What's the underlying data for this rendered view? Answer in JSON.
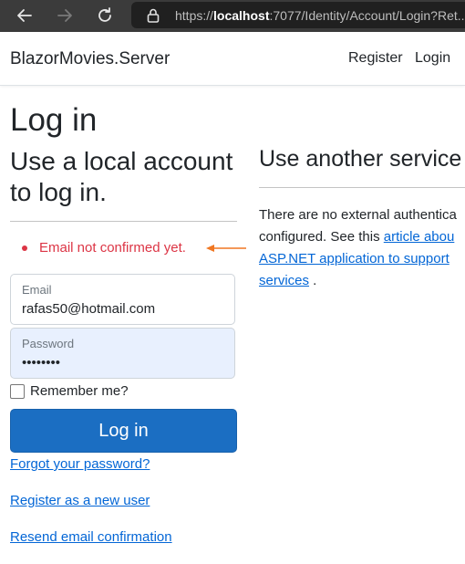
{
  "browser": {
    "back_icon": "arrow-left-icon",
    "forward_icon": "arrow-right-icon",
    "reload_icon": "reload-icon",
    "lock_icon": "lock-icon",
    "url_prefix": "https://",
    "url_host": "localhost",
    "url_rest": ":7077/Identity/Account/Login?Ret..."
  },
  "header": {
    "brand": "BlazorMovies.Server",
    "nav": [
      "Register",
      "Login"
    ]
  },
  "page": {
    "title": "Log in",
    "local_heading": "Use a local account to log in.",
    "external_heading": "Use another service",
    "error_message": "Email not confirmed yet.",
    "email_label": "Email",
    "email_value": "rafas50@hotmail.com",
    "password_label": "Password",
    "password_value": "••••••••",
    "remember_label": "Remember me?",
    "login_button": "Log in",
    "links": {
      "forgot": "Forgot your password?",
      "register": "Register as a new user",
      "resend": "Resend email confirmation"
    },
    "external_text_1": "There are no external authentica",
    "external_text_2": "configured. See this ",
    "external_link_1": "article abou",
    "external_link_2": "ASP.NET application to support",
    "external_link_3": "services",
    "external_text_3": " ."
  },
  "colors": {
    "accent": "#1b6ec2",
    "error": "#dc3545",
    "link": "#0366d6",
    "annotation_arrow": "#f07722"
  }
}
